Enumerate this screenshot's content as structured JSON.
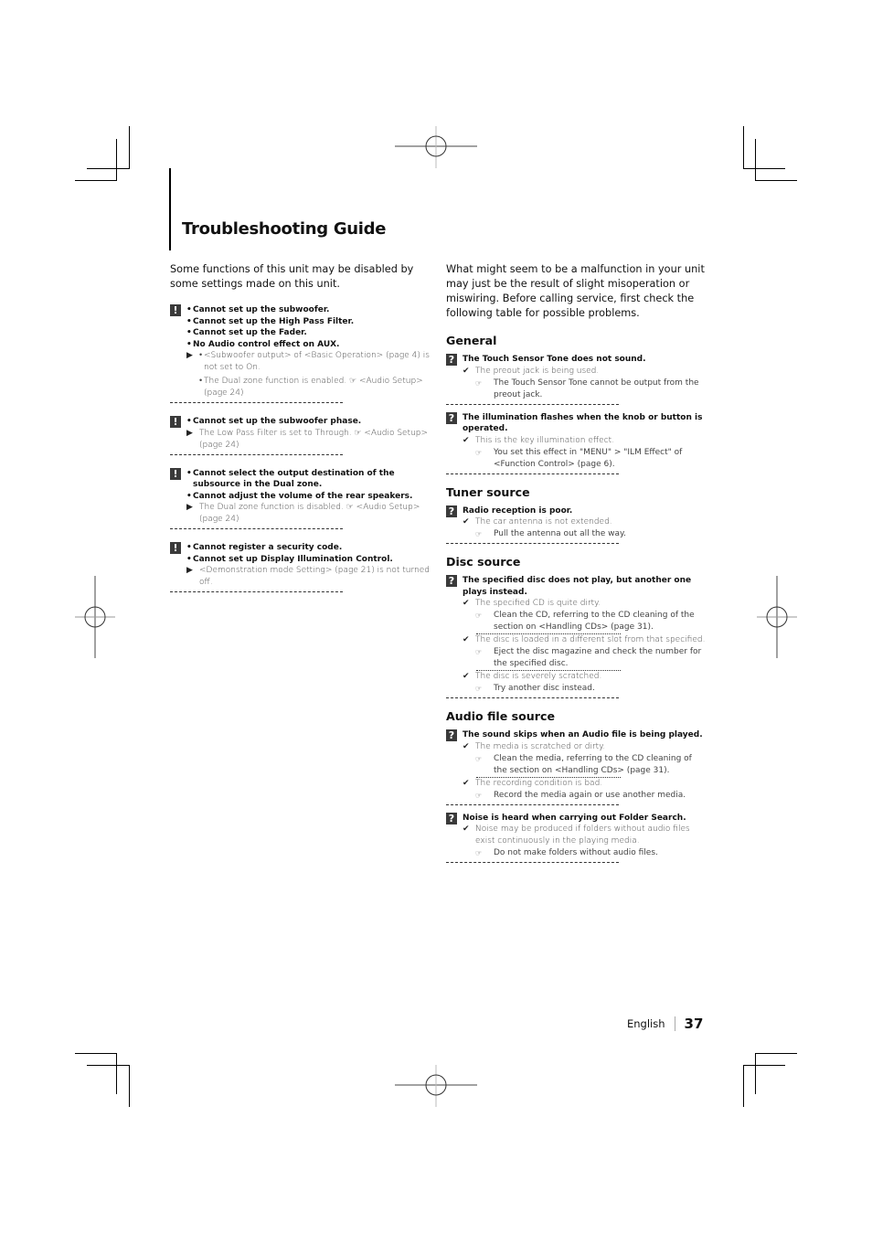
{
  "page": {
    "title": "Troubleshooting Guide",
    "language": "English",
    "page_number": "37"
  },
  "left": {
    "intro": "Some functions of this unit may be disabled by some settings made on this unit.",
    "badge": "!",
    "blocks": [
      {
        "issues": [
          "Cannot set up the subwoofer.",
          "Cannot set up the High Pass Filter.",
          "Cannot set up the Fader.",
          "No Audio control effect on AUX."
        ],
        "causes": [
          "<Subwoofer output> of <Basic Operation> (page 4) is not set to On.",
          "The Dual zone function is enabled. ☞ <Audio Setup> (page 24)"
        ]
      },
      {
        "issues": [
          "Cannot set up the subwoofer phase."
        ],
        "causes": [
          "The Low Pass Filter is set to Through. ☞ <Audio Setup> (page 24)"
        ]
      },
      {
        "issues": [
          "Cannot select the output destination of the subsource in the Dual zone.",
          "Cannot adjust the volume of the rear speakers."
        ],
        "causes": [
          "The Dual zone function is disabled. ☞ <Audio Setup> (page 24)"
        ]
      },
      {
        "issues": [
          "Cannot register a security code.",
          "Cannot set up Display Illumination Control."
        ],
        "causes": [
          "<Demonstration mode Setting> (page 21) is not turned off."
        ]
      }
    ]
  },
  "right": {
    "intro": "What might seem to be a malfunction in your unit may just be the result of slight misoperation or miswiring. Before calling service, first check the following table for possible problems.",
    "badge": "?",
    "sections": [
      {
        "heading": "General",
        "problems": [
          {
            "problem": "The Touch Sensor Tone does not sound.",
            "causes": [
              {
                "cause": "The preout jack is being used.",
                "remedy": "The Touch Sensor Tone cannot be output from the preout jack."
              }
            ]
          },
          {
            "problem": "The illumination flashes when the knob or button is operated.",
            "causes": [
              {
                "cause": "This is the key illumination effect.",
                "remedy": "You set this effect in \"MENU\" > \"ILM Effect\" of <Function Control> (page 6)."
              }
            ]
          }
        ]
      },
      {
        "heading": "Tuner source",
        "problems": [
          {
            "problem": "Radio reception is poor.",
            "causes": [
              {
                "cause": "The car antenna is not extended.",
                "remedy": "Pull the antenna out all the way."
              }
            ]
          }
        ]
      },
      {
        "heading": "Disc source",
        "problems": [
          {
            "problem": "The specified disc does not play, but another one plays instead.",
            "causes": [
              {
                "cause": "The specified CD is quite dirty.",
                "remedy": "Clean the CD, referring to the CD cleaning of the section on <Handling CDs> (page 31)."
              },
              {
                "cause": "The disc is loaded in a different slot from that specified.",
                "remedy": "Eject the disc magazine and check the number for the specified disc."
              },
              {
                "cause": "The disc is severely scratched.",
                "remedy": "Try another disc instead."
              }
            ]
          }
        ]
      },
      {
        "heading": "Audio file source",
        "problems": [
          {
            "problem": "The sound skips when an Audio file is being played.",
            "causes": [
              {
                "cause": "The media is scratched or dirty.",
                "remedy": "Clean the media, referring to the CD cleaning of the section on <Handling CDs> (page 31)."
              },
              {
                "cause": "The recording condition is bad.",
                "remedy": "Record the media again or use another media."
              }
            ]
          },
          {
            "problem": "Noise is heard when carrying out Folder Search.",
            "causes": [
              {
                "cause": "Noise may be produced if folders without audio files exist continuously in the playing media.",
                "remedy": "Do not make folders without audio files."
              }
            ]
          }
        ]
      }
    ]
  },
  "icons": {
    "arrow": "▶",
    "check": "✔",
    "reference": "☞",
    "bullet": "•"
  }
}
